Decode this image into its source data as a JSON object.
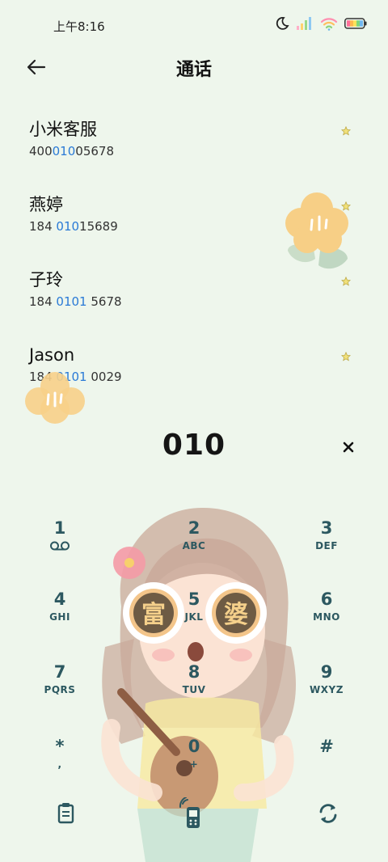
{
  "status": {
    "time": "上午8:16"
  },
  "header": {
    "title": "通话"
  },
  "contacts": [
    {
      "name": "小米客服",
      "number_pre": "400",
      "number_match": "010",
      "number_post": "05678"
    },
    {
      "name": "燕婷",
      "number_pre": "184 ",
      "number_match": "010",
      "number_post": "15689"
    },
    {
      "name": "子玲",
      "number_pre": "184 ",
      "number_match": "0101",
      "number_post": " 5678"
    },
    {
      "name": "Jason",
      "number_pre": "184 ",
      "number_match": "0101",
      "number_post": " 0029"
    }
  ],
  "dialer": {
    "input": "010",
    "illustration_text_left": "富",
    "illustration_text_right": "婆"
  },
  "keypad": [
    {
      "digit": "1",
      "letters": ""
    },
    {
      "digit": "2",
      "letters": "ABC"
    },
    {
      "digit": "3",
      "letters": "DEF"
    },
    {
      "digit": "4",
      "letters": "GHI"
    },
    {
      "digit": "5",
      "letters": "JKL"
    },
    {
      "digit": "6",
      "letters": "MNO"
    },
    {
      "digit": "7",
      "letters": "PQRS"
    },
    {
      "digit": "8",
      "letters": "TUV"
    },
    {
      "digit": "9",
      "letters": "WXYZ"
    },
    {
      "digit": "*",
      "letters": ","
    },
    {
      "digit": "0",
      "letters": "+"
    },
    {
      "digit": "#",
      "letters": ""
    }
  ],
  "colors": {
    "background": "#eef6ec",
    "highlight": "#2a7ad6",
    "keypad": "#2c5860",
    "star": "#e8d26a"
  }
}
